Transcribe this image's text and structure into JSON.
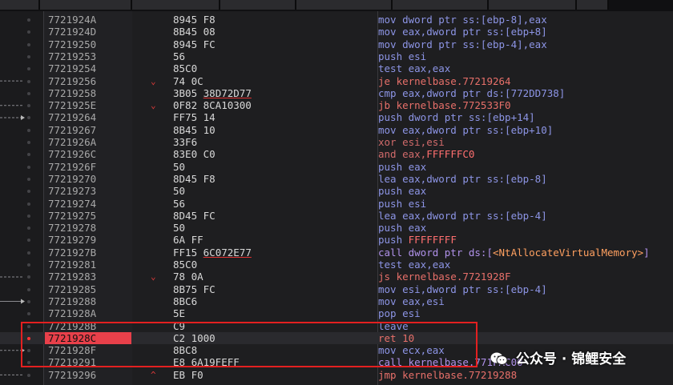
{
  "toolbar": [
    "",
    "",
    "",
    "",
    "",
    ""
  ],
  "rows": [
    {
      "addr": "7721924A",
      "jm": "",
      "bytes": "8945 F8",
      "ref": "",
      "asm": [
        [
          "mov",
          "m-mov"
        ],
        [
          " dword ptr ss:[ebp-8],eax",
          "m-mov"
        ]
      ]
    },
    {
      "addr": "7721924D",
      "jm": "",
      "bytes": "8B45 08",
      "ref": "",
      "asm": [
        [
          "mov",
          "m-mov"
        ],
        [
          " eax,dword ptr ss:[ebp+8]",
          "m-mov"
        ]
      ]
    },
    {
      "addr": "77219250",
      "jm": "",
      "bytes": "8945 FC",
      "ref": "",
      "asm": [
        [
          "mov",
          "m-mov"
        ],
        [
          " dword ptr ss:[ebp-4],eax",
          "m-mov"
        ]
      ]
    },
    {
      "addr": "77219253",
      "jm": "",
      "bytes": "56",
      "ref": "",
      "asm": [
        [
          "push esi",
          "m-mov"
        ]
      ]
    },
    {
      "addr": "77219254",
      "jm": "",
      "bytes": "85C0",
      "ref": "",
      "asm": [
        [
          "test eax,eax",
          "m-mov"
        ]
      ]
    },
    {
      "addr": "77219256",
      "jm": "⌄",
      "bytes": "74 0C",
      "ref": "",
      "asm": [
        [
          "je kernelbase.77219264",
          "m-jmp"
        ]
      ]
    },
    {
      "addr": "77219258",
      "jm": "",
      "bytes": "3B05 ",
      "ref": "38D72D77",
      "asm": [
        [
          "cmp eax,dword ptr ds:[772DD738]",
          "m-mov"
        ]
      ]
    },
    {
      "addr": "7721925E",
      "jm": "⌄",
      "bytes": "0F82 8CA10300",
      "ref": "",
      "asm": [
        [
          "jb kernelbase.772533F0",
          "m-jmp"
        ]
      ]
    },
    {
      "addr": "77219264",
      "jm": "",
      "bytes": "FF75 14",
      "ref": "",
      "asm": [
        [
          "push dword ptr ss:[ebp+14]",
          "m-mov"
        ]
      ]
    },
    {
      "addr": "77219267",
      "jm": "",
      "bytes": "8B45 10",
      "ref": "",
      "asm": [
        [
          "mov eax,dword ptr ss:[ebp+10]",
          "m-mov"
        ]
      ]
    },
    {
      "addr": "7721926A",
      "jm": "",
      "bytes": "33F6",
      "ref": "",
      "asm": [
        [
          "xor esi,esi",
          "m-xor"
        ]
      ]
    },
    {
      "addr": "7721926C",
      "jm": "",
      "bytes": "83E0 C0",
      "ref": "",
      "asm": [
        [
          "and eax,",
          "m-and"
        ],
        [
          "FFFFFFC0",
          "m-imm"
        ]
      ]
    },
    {
      "addr": "7721926F",
      "jm": "",
      "bytes": "50",
      "ref": "",
      "asm": [
        [
          "push eax",
          "m-mov"
        ]
      ]
    },
    {
      "addr": "77219270",
      "jm": "",
      "bytes": "8D45 F8",
      "ref": "",
      "asm": [
        [
          "lea eax,dword ptr ss:[ebp-8]",
          "m-mov"
        ]
      ]
    },
    {
      "addr": "77219273",
      "jm": "",
      "bytes": "50",
      "ref": "",
      "asm": [
        [
          "push eax",
          "m-mov"
        ]
      ]
    },
    {
      "addr": "77219274",
      "jm": "",
      "bytes": "56",
      "ref": "",
      "asm": [
        [
          "push esi",
          "m-mov"
        ]
      ]
    },
    {
      "addr": "77219275",
      "jm": "",
      "bytes": "8D45 FC",
      "ref": "",
      "asm": [
        [
          "lea eax,dword ptr ss:[ebp-4]",
          "m-mov"
        ]
      ]
    },
    {
      "addr": "77219278",
      "jm": "",
      "bytes": "50",
      "ref": "",
      "asm": [
        [
          "push eax",
          "m-mov"
        ]
      ]
    },
    {
      "addr": "77219279",
      "jm": "",
      "bytes": "6A FF",
      "ref": "",
      "asm": [
        [
          "push ",
          "m-mov"
        ],
        [
          "FFFFFFFF",
          "m-imm"
        ]
      ]
    },
    {
      "addr": "7721927B",
      "jm": "",
      "bytes": "FF15 ",
      "ref": "6C072E77",
      "asm": [
        [
          "call dword ptr ds:[",
          "m-call"
        ],
        [
          "<NtAllocateVirtualMemory>",
          "sym"
        ],
        [
          "]",
          "m-call"
        ]
      ]
    },
    {
      "addr": "77219281",
      "jm": "",
      "bytes": "85C0",
      "ref": "",
      "asm": [
        [
          "test eax,eax",
          "m-mov"
        ]
      ]
    },
    {
      "addr": "77219283",
      "jm": "⌄",
      "bytes": "78 0A",
      "ref": "",
      "asm": [
        [
          "js kernelbase.7721928F",
          "m-jmp"
        ]
      ]
    },
    {
      "addr": "77219285",
      "jm": "",
      "bytes": "8B75 FC",
      "ref": "",
      "asm": [
        [
          "mov esi,dword ptr ss:[ebp-4]",
          "m-mov"
        ]
      ]
    },
    {
      "addr": "77219288",
      "jm": "",
      "bytes": "8BC6",
      "ref": "",
      "asm": [
        [
          "mov eax,esi",
          "m-mov"
        ]
      ]
    },
    {
      "addr": "7721928A",
      "jm": "",
      "bytes": "5E",
      "ref": "",
      "asm": [
        [
          "pop esi",
          "m-mov"
        ]
      ]
    },
    {
      "addr": "7721928B",
      "jm": "",
      "bytes": "C9",
      "ref": "",
      "asm": [
        [
          "leave",
          "m-mov"
        ]
      ]
    },
    {
      "addr": "7721928C",
      "jm": "",
      "bytes": "C2 1000",
      "ref": "",
      "asm": [
        [
          "ret 10",
          "m-jmp"
        ]
      ],
      "bp": true
    },
    {
      "addr": "7721928F",
      "jm": "",
      "bytes": "8BC8",
      "ref": "",
      "asm": [
        [
          "mov ecx,eax",
          "m-mov"
        ]
      ]
    },
    {
      "addr": "77219291",
      "jm": "",
      "bytes": "E8 6A19FEFF",
      "ref": "",
      "asm": [
        [
          "call kernelbase.771FAC00",
          "m-call"
        ]
      ]
    },
    {
      "addr": "77219296",
      "jm": "^",
      "bytes": "EB F0",
      "ref": "",
      "asm": [
        [
          "jmp kernelbase.77219288",
          "m-jmp"
        ]
      ]
    }
  ],
  "watermark": {
    "text": "公众号 · 锦鲤安全"
  }
}
